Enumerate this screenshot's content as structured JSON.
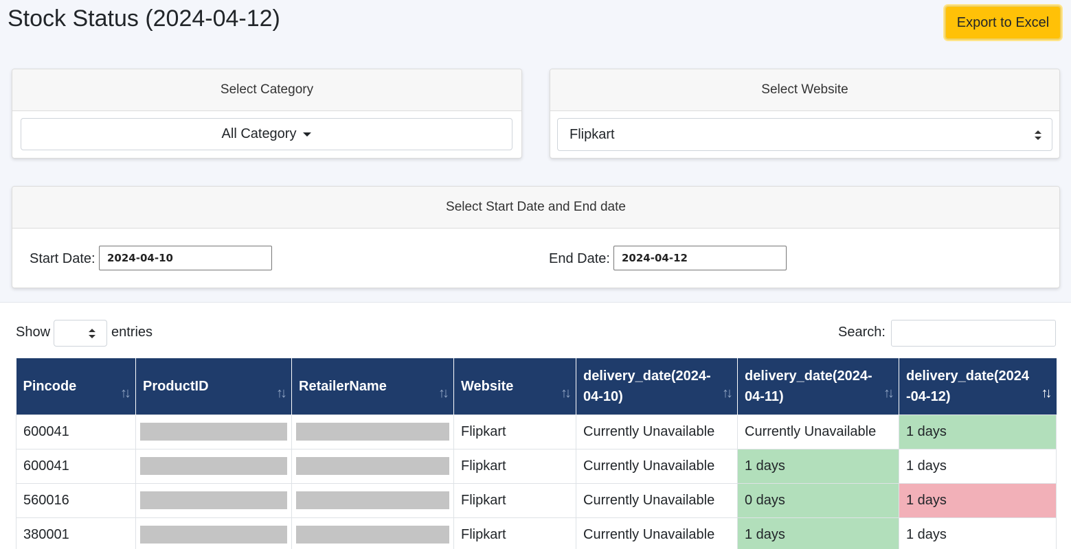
{
  "page": {
    "title": "Stock Status (2024-04-12)",
    "export_label": "Export to Excel"
  },
  "category": {
    "header": "Select Category",
    "selected": "All Category"
  },
  "website": {
    "header": "Select Website",
    "selected": "Flipkart"
  },
  "dates": {
    "header": "Select Start Date and End date",
    "start_label": "Start Date:",
    "start_value": "2024-04-10",
    "end_label": "End Date:",
    "end_value": "2024-04-12"
  },
  "controls": {
    "show_label": "Show",
    "entries_label": "entries",
    "search_label": "Search:"
  },
  "table": {
    "columns": [
      "Pincode",
      "ProductID",
      "RetailerName",
      "Website",
      "delivery_date(2024-04-10)",
      "delivery_date(2024-04-11)",
      "delivery_date(2024-04-12)"
    ],
    "rows": [
      {
        "pincode": "600041",
        "website": "Flipkart",
        "d1": "Currently Unavailable",
        "d2": "Currently Unavailable",
        "d3": "1 days"
      },
      {
        "pincode": "600041",
        "website": "Flipkart",
        "d1": "Currently Unavailable",
        "d2": "1 days",
        "d3": "1 days"
      },
      {
        "pincode": "560016",
        "website": "Flipkart",
        "d1": "Currently Unavailable",
        "d2": "0 days",
        "d3": "1 days"
      },
      {
        "pincode": "380001",
        "website": "Flipkart",
        "d1": "Currently Unavailable",
        "d2": "1 days",
        "d3": "1 days"
      }
    ]
  },
  "colors": {
    "header_bg": "#1f3c6b",
    "available": "#b2dfbb",
    "changed": "#f2b0b8",
    "export_button": "#ffc107"
  }
}
